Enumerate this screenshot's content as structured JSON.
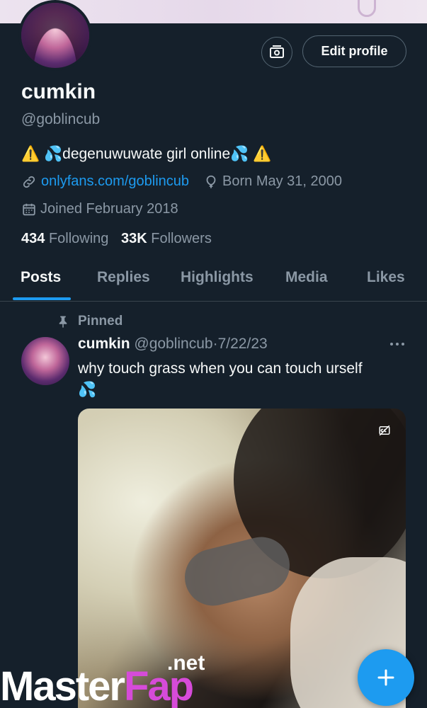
{
  "profile": {
    "name": "cumkin",
    "handle": "@goblincub",
    "bio": {
      "prefix": "⚠️ 💦",
      "text": "degenuwuwate girl online",
      "suffix": "💦 ⚠️"
    },
    "website": "onlyfans.com/goblincub",
    "birthday": "Born May 31, 2000",
    "joined": "Joined February 2018",
    "following_count": "434",
    "following_label": "Following",
    "followers_count": "33K",
    "followers_label": "Followers"
  },
  "actions": {
    "edit_profile": "Edit profile",
    "professional_icon": "money-icon"
  },
  "tabs": [
    "Posts",
    "Replies",
    "Highlights",
    "Media",
    "Likes"
  ],
  "active_tab": "Posts",
  "pinned_post": {
    "pinned_label": "Pinned",
    "author_name": "cumkin",
    "author_handle": "@goblincub",
    "separator": "·",
    "date": "7/22/23",
    "text": "why touch grass when you can touch urself",
    "emoji": "💦"
  },
  "watermark": {
    "part1": "Master",
    "part2": "Fap",
    "part3": ".net"
  },
  "colors": {
    "background": "#15202b",
    "accent": "#1d9bf0",
    "secondary_text": "#8b98a5",
    "border": "#38444d"
  }
}
